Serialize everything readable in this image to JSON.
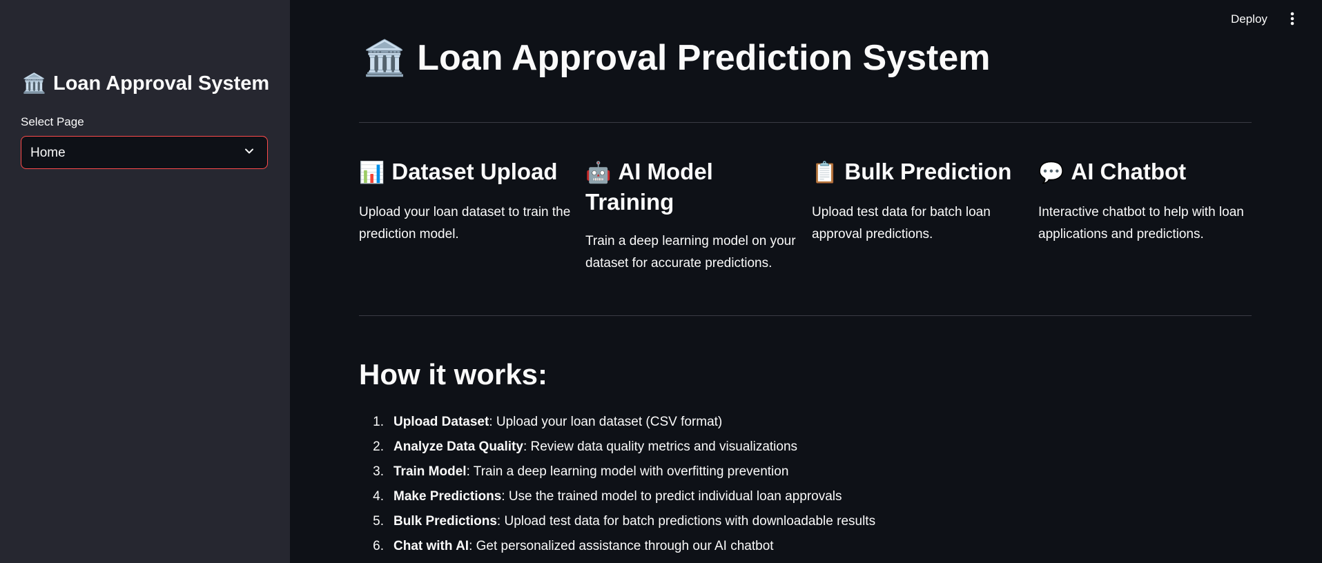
{
  "sidebar": {
    "title_emoji": "🏛️",
    "title": "Loan Approval System",
    "select_label": "Select Page",
    "select_value": "Home"
  },
  "header": {
    "deploy_label": "Deploy",
    "menu_icon": "kebab-menu-icon"
  },
  "main": {
    "title_emoji": "🏛️",
    "title": "Loan Approval Prediction System",
    "features": [
      {
        "emoji": "📊",
        "title": "Dataset Upload",
        "description": "Upload your loan dataset to train the prediction model."
      },
      {
        "emoji": "🤖",
        "title": "AI Model Training",
        "description": "Train a deep learning model on your dataset for accurate predictions."
      },
      {
        "emoji": "📋",
        "title": "Bulk Prediction",
        "description": "Upload test data for batch loan approval predictions."
      },
      {
        "emoji": "💬",
        "title": "AI Chatbot",
        "description": "Interactive chatbot to help with loan applications and predictions."
      }
    ],
    "how_title": "How it works:",
    "steps": [
      {
        "num": "1.",
        "strong": "Upload Dataset",
        "text": ": Upload your loan dataset (CSV format)"
      },
      {
        "num": "2.",
        "strong": "Analyze Data Quality",
        "text": ": Review data quality metrics and visualizations"
      },
      {
        "num": "3.",
        "strong": "Train Model",
        "text": ": Train a deep learning model with overfitting prevention"
      },
      {
        "num": "4.",
        "strong": "Make Predictions",
        "text": ": Use the trained model to predict individual loan approvals"
      },
      {
        "num": "5.",
        "strong": "Bulk Predictions",
        "text": ": Upload test data for batch predictions with downloadable results"
      },
      {
        "num": "6.",
        "strong": "Chat with AI",
        "text": ": Get personalized assistance through our AI chatbot"
      }
    ]
  },
  "colors": {
    "background": "#0e1117",
    "sidebar": "#262730",
    "accent": "#ff4b4b",
    "text": "#fafafa",
    "divider": "#3a3c45"
  }
}
